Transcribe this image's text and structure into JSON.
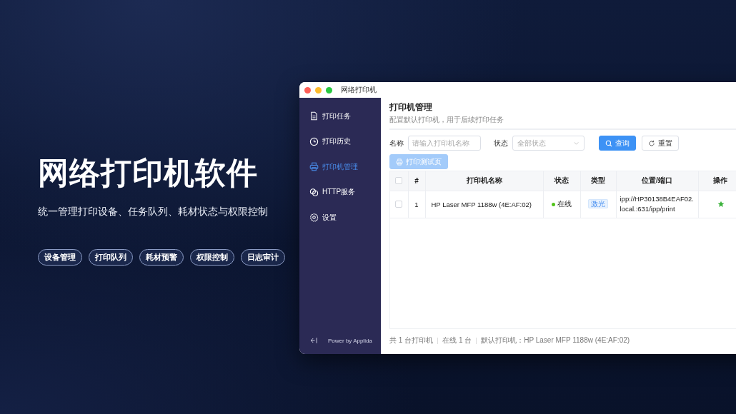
{
  "promo": {
    "title": "网络打印机软件",
    "subtitle": "统一管理打印设备、任务队列、耗材状态与权限控制",
    "tags": [
      "设备管理",
      "打印队列",
      "耗材预警",
      "权限控制",
      "日志审计"
    ]
  },
  "window": {
    "title": "网络打印机"
  },
  "sidebar": {
    "items": [
      {
        "label": "打印任务",
        "selected": false
      },
      {
        "label": "打印历史",
        "selected": false
      },
      {
        "label": "打印机管理",
        "selected": true
      },
      {
        "label": "HTTP服务",
        "selected": false
      },
      {
        "label": "设置",
        "selected": false
      }
    ],
    "footer": "Power by Applida"
  },
  "page": {
    "title": "打印机管理",
    "subtitle": "配置默认打印机，用于后续打印任务"
  },
  "filters": {
    "name_label": "名称",
    "name_placeholder": "请输入打印机名称",
    "status_label": "状态",
    "status_placeholder": "全部状态",
    "search_button": "查询",
    "reset_button": "重置"
  },
  "test_button": {
    "label": "打印测试页",
    "disabled": true
  },
  "table": {
    "select_all_checked": false,
    "columns": [
      "#",
      "打印机名称",
      "状态",
      "类型",
      "位置/端口",
      "操作"
    ],
    "rows": [
      {
        "checked": false,
        "index": "1",
        "name": "HP Laser MFP 1188w (4E:AF:02)",
        "status": "在线",
        "color": "#52c41a",
        "type": "激光",
        "location": "ipp://HP30138B4EAF02.local.:631/ipp/print",
        "is_default": true
      }
    ]
  },
  "status_bar": [
    "共 1 台打印机",
    "在线 1 台",
    "默认打印机：HP Laser MFP 1188w (4E:AF:02)"
  ]
}
